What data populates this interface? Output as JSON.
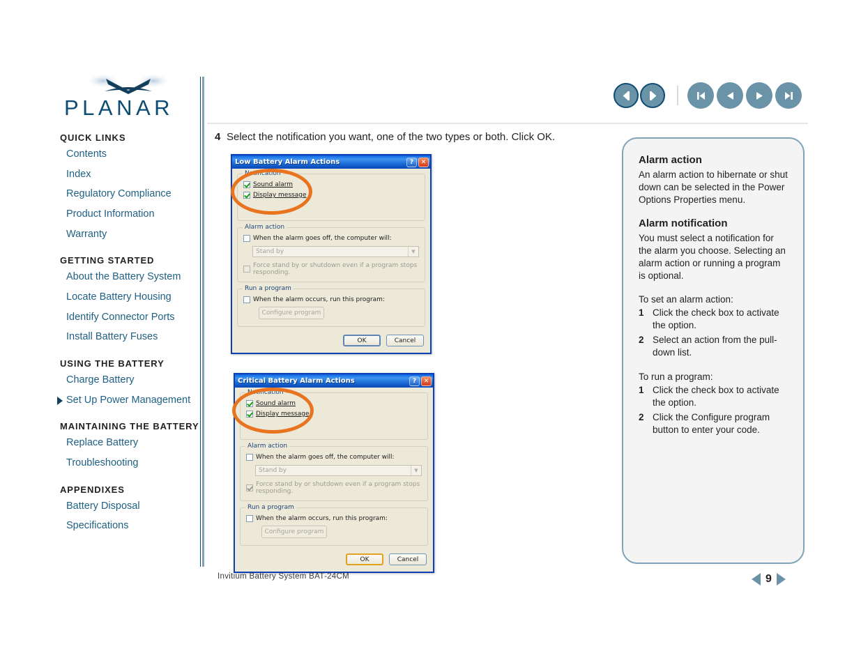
{
  "brand": {
    "logo_text": "PLANAR",
    "logo_icon": "planar-swoosh-logo"
  },
  "topnav": {
    "history_back": "Back",
    "history_forward": "Forward",
    "first_page": "First Page",
    "prev_page": "Previous Page",
    "next_page": "Next Page",
    "last_page": "Last Page"
  },
  "sidebar": {
    "sections": [
      {
        "title": "QUICK LINKS",
        "items": [
          {
            "label": "Contents",
            "current": false
          },
          {
            "label": "Index",
            "current": false
          },
          {
            "label": "Regulatory Compliance",
            "current": false
          },
          {
            "label": "Product Information",
            "current": false
          },
          {
            "label": "Warranty",
            "current": false
          }
        ]
      },
      {
        "title": "GETTING STARTED",
        "items": [
          {
            "label": "About the Battery System",
            "current": false
          },
          {
            "label": "Locate Battery Housing",
            "current": false
          },
          {
            "label": "Identify Connector Ports",
            "current": false
          },
          {
            "label": "Install Battery  Fuses",
            "current": false
          }
        ]
      },
      {
        "title": "USING THE BATTERY",
        "items": [
          {
            "label": "Charge Battery",
            "current": false
          },
          {
            "label": "Set Up Power Management",
            "current": true
          }
        ]
      },
      {
        "title": "MAINTAINING THE BATTERY",
        "items": [
          {
            "label": "Replace Battery",
            "current": false
          },
          {
            "label": "Troubleshooting",
            "current": false
          }
        ]
      },
      {
        "title": "APPENDIXES",
        "items": [
          {
            "label": "Battery Disposal",
            "current": false
          },
          {
            "label": "Specifications",
            "current": false
          }
        ]
      }
    ]
  },
  "main": {
    "step_number": "4",
    "step_text": "Select the notification you want, one of the two types or both. Click OK."
  },
  "dialog1": {
    "title": "Low Battery Alarm Actions",
    "help_btn": "?",
    "close_btn": "✕",
    "notification_legend": "Notification",
    "sound_alarm": "Sound alarm",
    "sound_alarm_checked": true,
    "display_message": "Display message",
    "display_message_checked": true,
    "alarm_action_legend": "Alarm action",
    "alarm_action_check": "When the alarm goes off, the computer will:",
    "alarm_action_checked": false,
    "combo_value": "Stand by",
    "force_text": "Force stand by or shutdown even if a program stops responding.",
    "force_checked": false,
    "run_program_legend": "Run a program",
    "run_program_check": "When the alarm occurs, run this program:",
    "run_program_checked": false,
    "configure_btn": "Configure program",
    "ok_btn": "OK",
    "cancel_btn": "Cancel"
  },
  "dialog2": {
    "title": "Critical Battery Alarm Actions",
    "help_btn": "?",
    "close_btn": "✕",
    "notification_legend": "Notification",
    "sound_alarm": "Sound alarm",
    "sound_alarm_checked": true,
    "display_message": "Display message",
    "display_message_checked": true,
    "alarm_action_legend": "Alarm action",
    "alarm_action_check": "When the alarm goes off, the computer will:",
    "alarm_action_checked": false,
    "combo_value": "Stand by",
    "force_text": "Force stand by or shutdown even if a program stops responding.",
    "force_checked": true,
    "run_program_legend": "Run a program",
    "run_program_check": "When the alarm occurs, run this program:",
    "run_program_checked": false,
    "configure_btn": "Configure program",
    "ok_btn": "OK",
    "cancel_btn": "Cancel"
  },
  "info_panel": {
    "heading1": "Alarm action",
    "para1": "An alarm action to hibernate or shut down can be selected in the Power Options Properties menu.",
    "heading2": "Alarm notification",
    "para2": "You must select a notification for the alarm you choose. Selecting an alarm action or running a program is optional.",
    "lead1": "To set an alarm action:",
    "list1": [
      {
        "num": "1",
        "text": "Click the check box to activate the option."
      },
      {
        "num": "2",
        "text": "Select an action from the pull-down list."
      }
    ],
    "lead2": "To run a program:",
    "list2": [
      {
        "num": "1",
        "text": "Click the check box to activate the option."
      },
      {
        "num": "2",
        "text": "Click the Configure program button to enter your code."
      }
    ]
  },
  "footer": {
    "caption": "Invitium Battery System BAT-24CM",
    "page_number": "9"
  },
  "colors": {
    "brand_navy": "#0d4d73",
    "link_blue": "#1f5f84",
    "nav_button": "#6b93a8",
    "panel_border": "#7fa3b8",
    "annotation_orange": "#e87420",
    "xp_title_blue": "#1a73e8"
  }
}
